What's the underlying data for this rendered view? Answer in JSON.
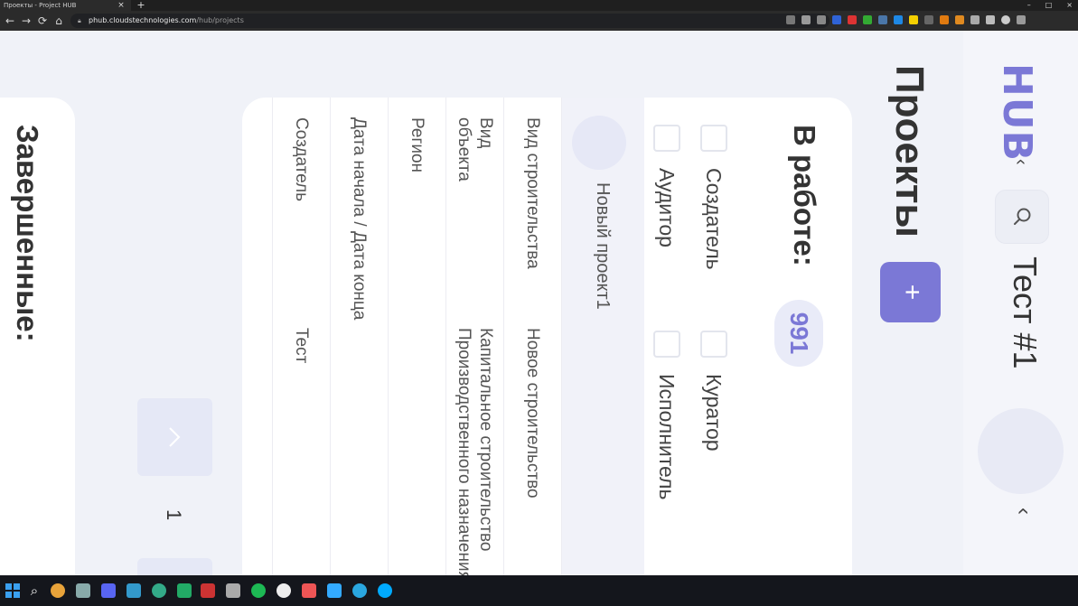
{
  "browser": {
    "tab_title": "Проекты - Project HUB",
    "tab_close": "×",
    "new_tab": "+",
    "window_controls": [
      "–",
      "□",
      "×"
    ],
    "nav": {
      "back": "←",
      "forward": "→",
      "reload": "⟳",
      "home": "⌂"
    },
    "url_host": "phub.cloudstechnologies.com",
    "url_path": "/hub/projects"
  },
  "app": {
    "logo": "HUB",
    "logo_chevron": "‹",
    "project_name": "Тест #1",
    "collapse_chevron": "‹",
    "page_title": "Проекты",
    "add_button": "+",
    "in_work": {
      "title": "В работе:",
      "count": "991",
      "filters": {
        "creator": "Создатель",
        "auditor": "Аудитор",
        "curator": "Куратор",
        "executor": "Исполнитель"
      },
      "project_card": {
        "name": "Новый проект1",
        "rows": [
          {
            "label": "Вид строительства",
            "value": "Новое строительство"
          },
          {
            "label": "Вид\nобъекта",
            "value": "Капитальное строительство\nПроизводственного назначения"
          },
          {
            "label": "Регион",
            "value": ""
          },
          {
            "label": "Дата начала / Дата конца",
            "value": ""
          },
          {
            "label": "Создатель",
            "value": "Тест"
          }
        ]
      }
    },
    "pagination": {
      "scroll_up": "^",
      "page": "1"
    },
    "done": {
      "title": "Завершенные:"
    }
  }
}
